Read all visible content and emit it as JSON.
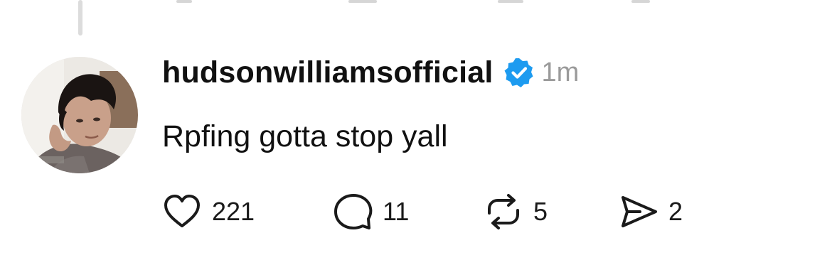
{
  "post": {
    "username": "hudsonwilliamsofficial",
    "verified": true,
    "timestamp": "1m",
    "text": "Rpfing gotta stop yall"
  },
  "actions": {
    "like": {
      "icon": "heart-icon",
      "count": "221"
    },
    "comment": {
      "icon": "comment-icon",
      "count": "11"
    },
    "repost": {
      "icon": "repost-icon",
      "count": "5"
    },
    "share": {
      "icon": "send-icon",
      "count": "2"
    }
  },
  "colors": {
    "verified_badge": "#1d9bf0",
    "timestamp": "#9a9a9a",
    "text": "#111111",
    "thread_line": "#dcdcdc"
  }
}
